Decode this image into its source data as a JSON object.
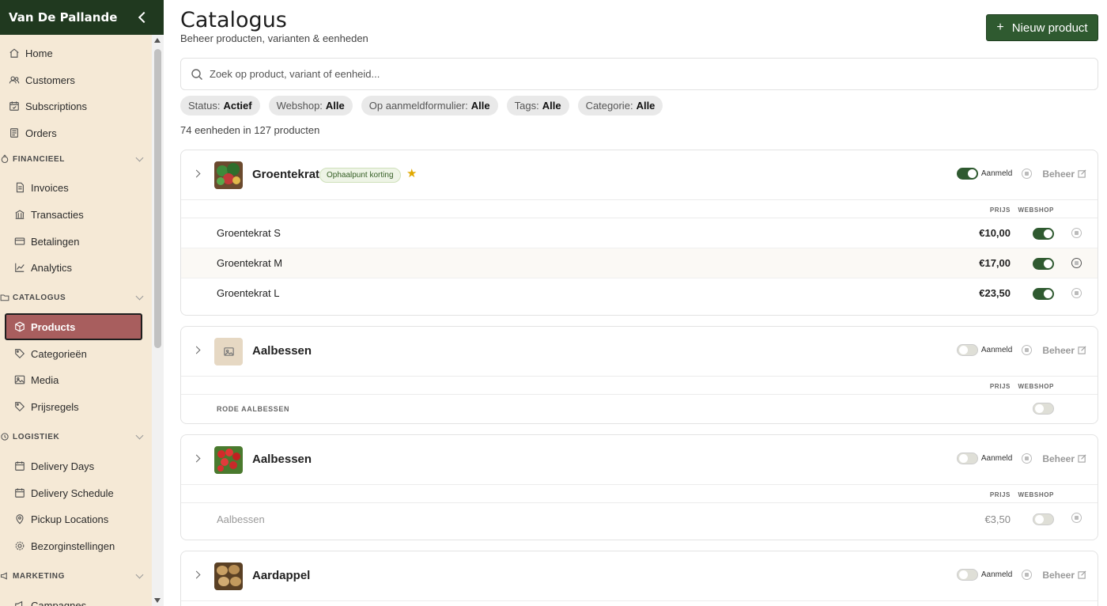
{
  "app": {
    "name": "Van De Pallande"
  },
  "sidebar": {
    "top": [
      {
        "label": "Home",
        "icon": "home-icon"
      },
      {
        "label": "Customers",
        "icon": "users-icon"
      },
      {
        "label": "Subscriptions",
        "icon": "calendar-check-icon"
      },
      {
        "label": "Orders",
        "icon": "receipt-icon"
      }
    ],
    "sections": [
      {
        "title": "FINANCIEEL",
        "items": [
          "Invoices",
          "Transacties",
          "Betalingen",
          "Analytics"
        ]
      },
      {
        "title": "CATALOGUS",
        "items": [
          "Products",
          "Categorieën",
          "Media",
          "Prijsregels"
        ]
      },
      {
        "title": "LOGISTIEK",
        "items": [
          "Delivery Days",
          "Delivery Schedule",
          "Pickup Locations",
          "Bezorginstellingen"
        ]
      },
      {
        "title": "MARKETING",
        "items": [
          "Campagnes"
        ]
      }
    ],
    "active": "Products"
  },
  "header": {
    "title": "Catalogus",
    "subtitle": "Beheer producten, varianten & eenheden",
    "new_button": "Nieuw product"
  },
  "search": {
    "placeholder": "Zoek op product, variant of eenheid..."
  },
  "filters": [
    {
      "label": "Status",
      "value": "Actief"
    },
    {
      "label": "Webshop",
      "value": "Alle"
    },
    {
      "label": "Op aanmeldformulier",
      "value": "Alle"
    },
    {
      "label": "Tags",
      "value": "Alle"
    },
    {
      "label": "Categorie",
      "value": "Alle"
    }
  ],
  "count_text": "74 eenheden in 127 producten",
  "labels": {
    "aanmeld": "Aanmeld",
    "beheer": "Beheer",
    "prijs": "PRIJS",
    "webshop": "WEBSHOP"
  },
  "products": [
    {
      "name": "Groentekrat",
      "badge": "Ophaalpunt korting",
      "starred": true,
      "aanmeld_on": true,
      "variants": [
        {
          "name": "Groentekrat S",
          "price": "€10,00",
          "webshop": true
        },
        {
          "name": "Groentekrat M",
          "price": "€17,00",
          "webshop": true
        },
        {
          "name": "Groentekrat L",
          "price": "€23,50",
          "webshop": true
        }
      ]
    },
    {
      "name": "Aalbessen",
      "aanmeld_on": false,
      "group": "RODE AALBESSEN"
    },
    {
      "name": "Aalbessen",
      "aanmeld_on": false,
      "variants": [
        {
          "name": "Aalbessen",
          "price": "€3,50",
          "webshop": false
        }
      ]
    },
    {
      "name": "Aardappel",
      "aanmeld_on": false
    }
  ],
  "colors": {
    "brand": "#20391f",
    "sidebar_bg": "#f5e9d6",
    "active": "#a85e5e",
    "button": "#2f5a30"
  }
}
